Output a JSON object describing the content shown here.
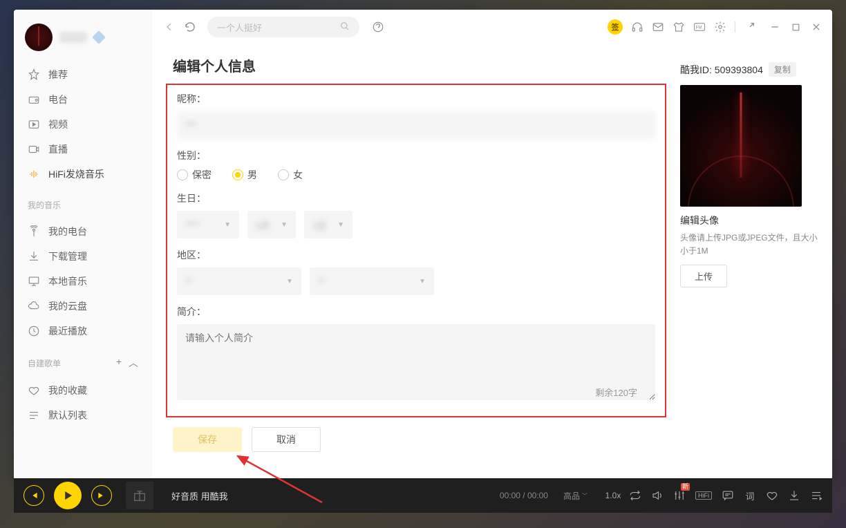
{
  "sidebar": {
    "nav": [
      {
        "icon": "star",
        "label": "推荐"
      },
      {
        "icon": "radio",
        "label": "电台"
      },
      {
        "icon": "video",
        "label": "视频"
      },
      {
        "icon": "live",
        "label": "直播"
      },
      {
        "icon": "hifi",
        "label": "HiFi发烧音乐"
      }
    ],
    "section_mymusic": "我的音乐",
    "mymusic": [
      {
        "icon": "myradio",
        "label": "我的电台"
      },
      {
        "icon": "download",
        "label": "下载管理"
      },
      {
        "icon": "local",
        "label": "本地音乐"
      },
      {
        "icon": "cloud",
        "label": "我的云盘"
      },
      {
        "icon": "recent",
        "label": "最近播放"
      }
    ],
    "section_playlist": "自建歌单",
    "playlists": [
      {
        "icon": "heart",
        "label": "我的收藏"
      },
      {
        "icon": "list",
        "label": "默认列表"
      }
    ]
  },
  "topbar": {
    "search_placeholder": "一个人挺好",
    "sign_badge": "签"
  },
  "page": {
    "title": "编辑个人信息",
    "labels": {
      "nickname": "昵称：",
      "gender": "性别：",
      "birthday": "生日：",
      "region": "地区：",
      "bio": "简介："
    },
    "gender_opts": {
      "secret": "保密",
      "male": "男",
      "female": "女"
    },
    "bio_placeholder": "请输入个人简介",
    "char_remaining": "剩余120字",
    "save": "保存",
    "cancel": "取消"
  },
  "right": {
    "id_label": "酷我ID: 509393804",
    "copy": "复制",
    "title": "编辑头像",
    "desc": "头像请上传JPG或JPEG文件，且大小小于1M",
    "upload": "上传"
  },
  "player": {
    "track": "好音质 用酷我",
    "time": "00:00 / 00:00",
    "quality": "高品",
    "speed": "1.0x",
    "hifi": "HiFi",
    "new": "新"
  }
}
